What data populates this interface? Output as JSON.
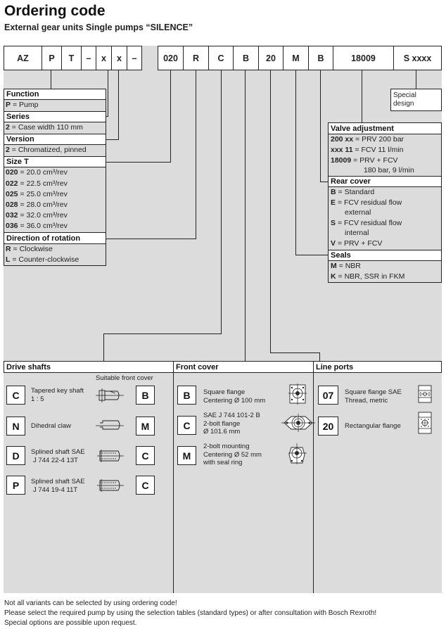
{
  "header": {
    "title": "Ordering code",
    "subtitle": "External gear units Single pumps “SILENCE”"
  },
  "code_fields": [
    "AZ",
    "P",
    "T",
    "–",
    "x",
    "x",
    "–",
    "020",
    "R",
    "C",
    "B",
    "20",
    "M",
    "B",
    "18009",
    "S xxxx"
  ],
  "special_design": {
    "line1": "Special",
    "line2": "design"
  },
  "left_panel": {
    "function": {
      "title": "Function",
      "items": [
        {
          "key": "P",
          "text": "= Pump"
        }
      ]
    },
    "series": {
      "title": "Series",
      "items": [
        {
          "key": "2",
          "text": "= Case width 110 mm"
        }
      ]
    },
    "version": {
      "title": "Version",
      "items": [
        {
          "key": "2",
          "text": "= Chromatized, pinned"
        }
      ]
    },
    "size": {
      "title": "Size T",
      "items": [
        {
          "key": "020",
          "text": "= 20.0 cm³/rev"
        },
        {
          "key": "022",
          "text": "= 22.5 cm³/rev"
        },
        {
          "key": "025",
          "text": "= 25.0 cm³/rev"
        },
        {
          "key": "028",
          "text": "= 28.0 cm³/rev"
        },
        {
          "key": "032",
          "text": "= 32.0 cm³/rev"
        },
        {
          "key": "036",
          "text": "= 36.0 cm³/rev"
        }
      ]
    },
    "rotation": {
      "title": "Direction of rotation",
      "items": [
        {
          "key": "R",
          "text": "= Clockwise"
        },
        {
          "key": "L",
          "text": "= Counter-clockwise"
        }
      ]
    }
  },
  "right_panel": {
    "valve": {
      "title": "Valve adjustment",
      "items": [
        {
          "key": "200 xx",
          "text": "= PRV 200 bar"
        },
        {
          "key": "xxx 11",
          "text": "= FCV 11 l/min"
        },
        {
          "key": "18009",
          "text": "= PRV + FCV"
        },
        {
          "key": "",
          "text": "180 bar, 9 l/min"
        }
      ]
    },
    "rear": {
      "title": "Rear cover",
      "items": [
        {
          "key": "B",
          "text": "= Standard"
        },
        {
          "key": "E",
          "text": "= FCV residual flow"
        },
        {
          "key": "",
          "text": "external"
        },
        {
          "key": "S",
          "text": "= FCV residual flow"
        },
        {
          "key": "",
          "text": "internal"
        },
        {
          "key": "V",
          "text": "= PRV + FCV"
        }
      ]
    },
    "seals": {
      "title": "Seals",
      "items": [
        {
          "key": "M",
          "text": "= NBR"
        },
        {
          "key": "K",
          "text": "= NBR, SSR in FKM"
        }
      ]
    }
  },
  "drive_shafts": {
    "title": "Drive shafts",
    "suitable_label": "Suitable front cover",
    "items": [
      {
        "code": "C",
        "line1": "Tapered key shaft",
        "line2": "1 : 5",
        "icon": "tapered-shaft-icon",
        "cover": "B"
      },
      {
        "code": "N",
        "line1": "Dihedral claw",
        "line2": "",
        "icon": "dihedral-claw-icon",
        "cover": "M"
      },
      {
        "code": "D",
        "line1": "Splined shaft SAE",
        "line2": "J 744 22-4 13T",
        "icon": "splined-shaft-icon",
        "cover": "C"
      },
      {
        "code": "P",
        "line1": "Splined shaft SAE",
        "line2": "J 744 19-4 11T",
        "icon": "splined-shaft-icon",
        "cover": "C"
      }
    ]
  },
  "front_cover": {
    "title": "Front cover",
    "items": [
      {
        "code": "B",
        "line1": "Square flange",
        "line2": "Centering Ø 100 mm",
        "line3": "",
        "icon": "square-flange-icon"
      },
      {
        "code": "C",
        "line1": "SAE J 744 101-2 B",
        "line2": "2-bolt flange",
        "line3": "Ø 101.6 mm",
        "icon": "two-bolt-flange-icon"
      },
      {
        "code": "M",
        "line1": "2-bolt mounting",
        "line2": "Centering Ø 52 mm",
        "line3": "with seal ring",
        "icon": "two-bolt-mounting-icon"
      }
    ]
  },
  "line_ports": {
    "title": "Line ports",
    "items": [
      {
        "code": "07",
        "line1": "Square flange SAE",
        "line2": "Thread, metric",
        "icon": "square-flange-port-icon"
      },
      {
        "code": "20",
        "line1": "Rectangular flange",
        "line2": "",
        "icon": "rectangular-flange-port-icon"
      }
    ]
  },
  "footer": [
    "Not all variants can be selected by using ordering code!",
    "Please select the required pump by using the selection tables (standard types) or after consultation with Bosch Rexroth!",
    "Special options are possible upon request."
  ]
}
